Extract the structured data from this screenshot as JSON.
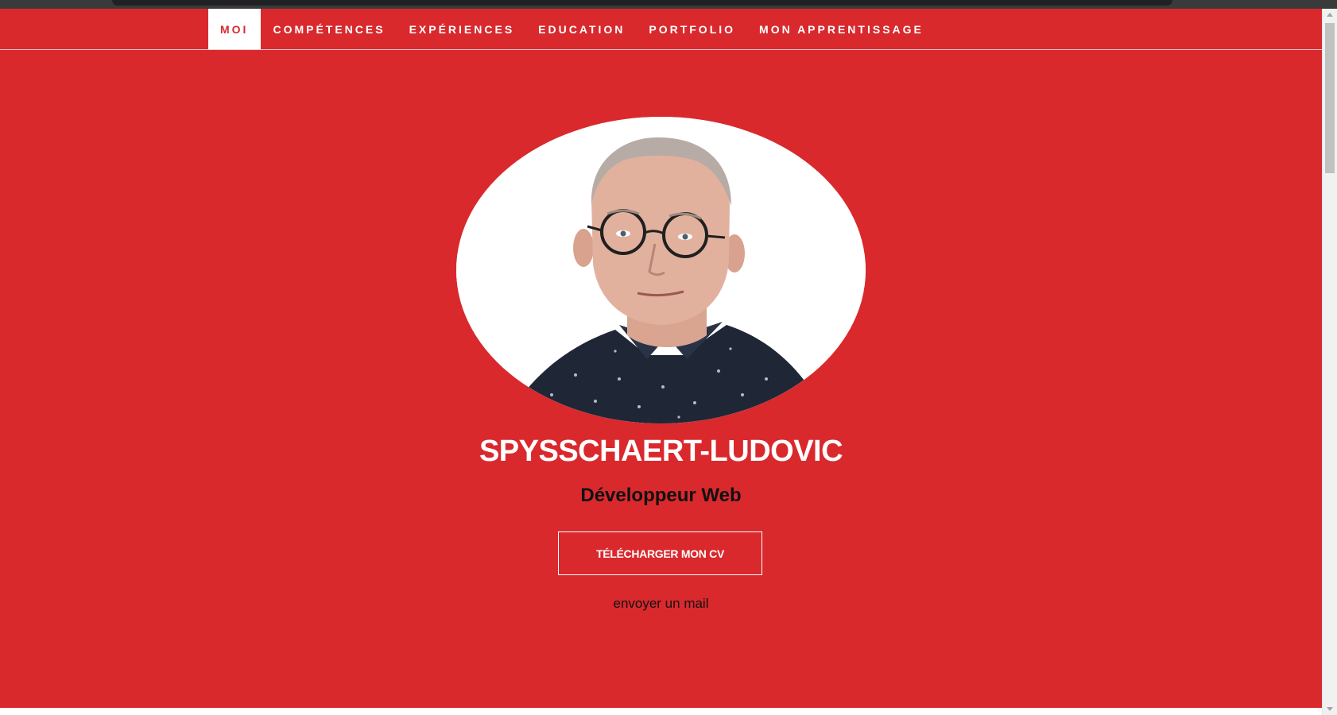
{
  "nav": {
    "items": [
      {
        "label": "MOI",
        "active": true
      },
      {
        "label": "COMPÉTENCES",
        "active": false
      },
      {
        "label": "EXPÉRIENCES",
        "active": false
      },
      {
        "label": "EDUCATION",
        "active": false
      },
      {
        "label": "PORTFOLIO",
        "active": false
      },
      {
        "label": "MON APPRENTISSAGE",
        "active": false
      }
    ]
  },
  "hero": {
    "name": "SPYSSCHAERT-LUDOVIC",
    "role": "Développeur Web",
    "cv_button": "TÉLÉCHARGER MON CV",
    "mail_link": "envoyer un mail"
  },
  "colors": {
    "accent": "#d9292d",
    "text_light": "#ffffff",
    "text_dark": "#111111"
  }
}
